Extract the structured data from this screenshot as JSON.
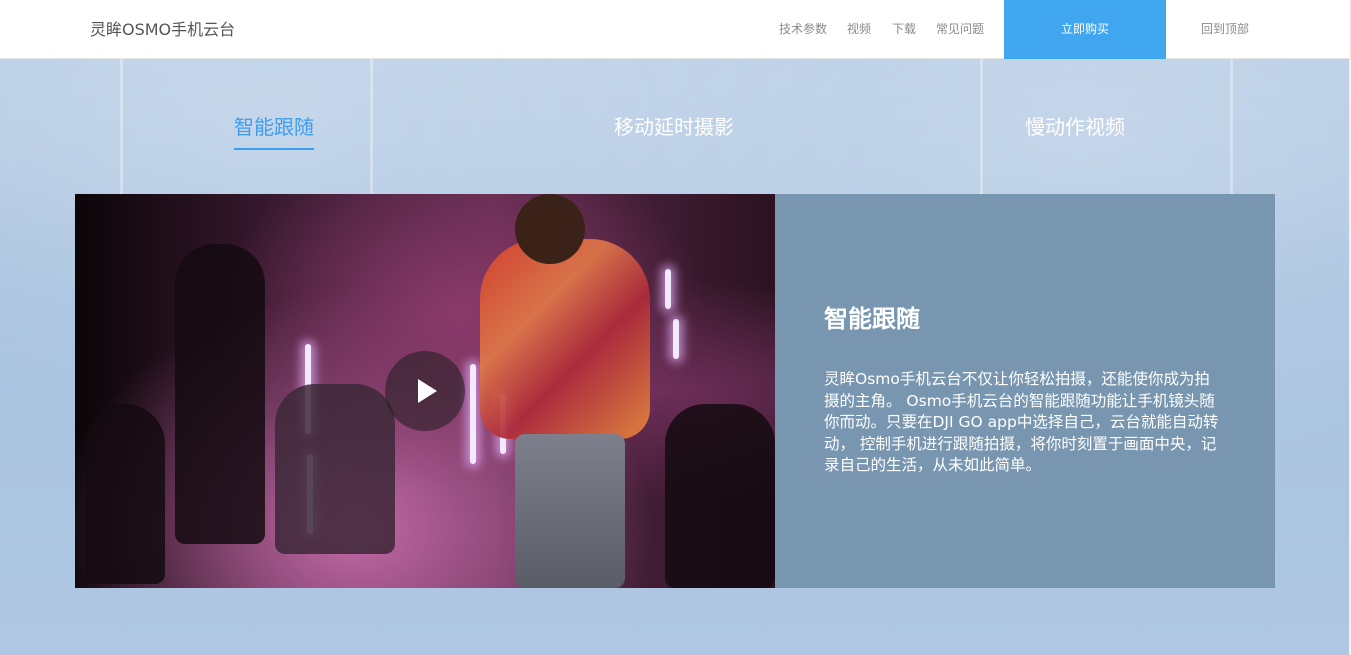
{
  "header": {
    "brand": "灵眸OSMO手机云台",
    "nav": {
      "specs": "技术参数",
      "video": "视频",
      "download": "下载",
      "faq": "常见问题"
    },
    "buy_label": "立即购买",
    "back_to_top": "回到顶部"
  },
  "tabs": [
    {
      "label": "智能跟随",
      "active": true
    },
    {
      "label": "移动延时摄影",
      "active": false
    },
    {
      "label": "慢动作视频",
      "active": false
    }
  ],
  "feature": {
    "title": "智能跟随",
    "description": "灵眸Osmo手机云台不仅让你轻松拍摄，还能使你成为拍摄的主角。 Osmo手机云台的智能跟随功能让手机镜头随你而动。只要在DJI GO app中选择自己，云台就能自动转动， 控制手机进行跟随拍摄，将你时刻置于画面中央，记录自己的生活，从未如此简单。"
  },
  "colors": {
    "accent": "#40a6f0",
    "active_tab": "#3d9ef0",
    "text_panel_bg": "#7896b0"
  },
  "icons": {
    "play": "play-icon"
  }
}
